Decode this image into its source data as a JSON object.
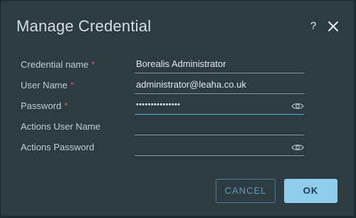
{
  "dialog": {
    "title": "Manage Credential",
    "help_label": "?",
    "close_icon": "close-icon"
  },
  "form": {
    "rows": [
      {
        "label": "Credential name",
        "required_mark": "*",
        "value": "Borealis Administrator"
      },
      {
        "label": "User Name",
        "required_mark": "*",
        "value": "administrator@leaha.co.uk"
      },
      {
        "label": "Password",
        "required_mark": "*",
        "value": "•••••••••••••••",
        "reveal_icon": "eye-icon"
      },
      {
        "label": "Actions User Name",
        "value": ""
      },
      {
        "label": "Actions Password",
        "value": "",
        "reveal_icon": "eye-icon"
      }
    ]
  },
  "buttons": {
    "cancel_label": "CANCEL",
    "ok_label": "OK"
  },
  "colors": {
    "dialog_bg": "#2d3b43",
    "required": "#e15a4f",
    "focus_underline": "#49aee3",
    "primary_button": "#8fcbec",
    "secondary_button_text": "#5c9ec2"
  }
}
